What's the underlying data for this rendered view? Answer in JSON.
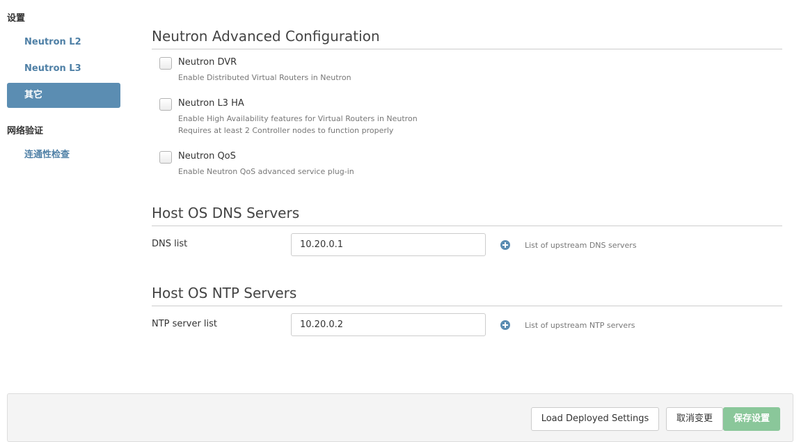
{
  "sidebar": {
    "group1_title": "设置",
    "items": [
      {
        "label": "Neutron L2"
      },
      {
        "label": "Neutron L3"
      },
      {
        "label": "其它"
      }
    ],
    "group2_title": "网络验证",
    "items2": [
      {
        "label": "连通性检查"
      }
    ]
  },
  "advanced": {
    "title": "Neutron Advanced Configuration",
    "options": [
      {
        "label": "Neutron DVR",
        "desc1": "Enable Distributed Virtual Routers in Neutron",
        "checked": false
      },
      {
        "label": "Neutron L3 HA",
        "desc1": "Enable High Availability features for Virtual Routers in Neutron",
        "desc2": "Requires at least 2 Controller nodes to function properly",
        "checked": false
      },
      {
        "label": "Neutron QoS",
        "desc1": "Enable Neutron QoS advanced service plug-in",
        "checked": false
      }
    ]
  },
  "dns": {
    "title": "Host OS DNS Servers",
    "label": "DNS list",
    "value": "10.20.0.1",
    "hint": "List of upstream DNS servers"
  },
  "ntp": {
    "title": "Host OS NTP Servers",
    "label": "NTP server list",
    "value": "10.20.0.2",
    "hint": "List of upstream NTP servers"
  },
  "footer": {
    "load_label": "Load Deployed Settings",
    "cancel_label": "取消变更",
    "save_label": "保存设置"
  },
  "colors": {
    "accent": "#5b8db2",
    "link": "#4f80a6",
    "success": "#8ac79a"
  }
}
